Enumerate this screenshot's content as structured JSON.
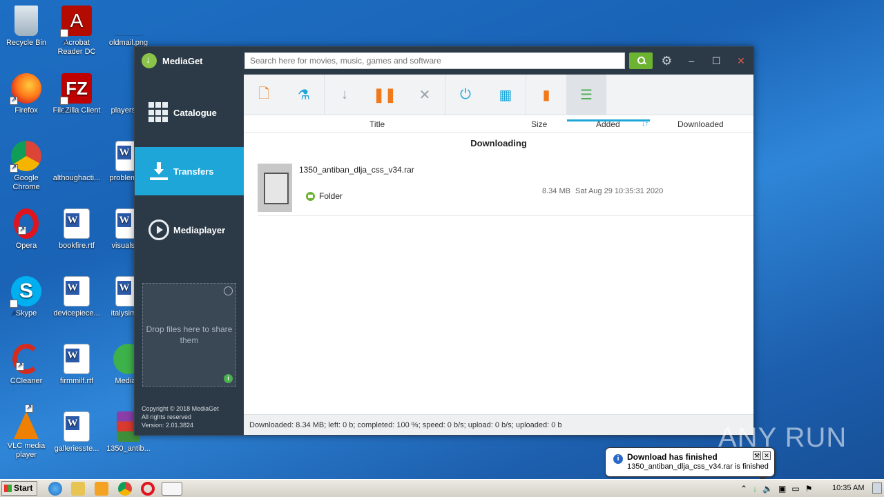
{
  "desktop": {
    "icons": [
      {
        "label": "Recycle Bin"
      },
      {
        "label": "Acrobat Reader DC"
      },
      {
        "label": "oldmail.png"
      },
      {
        "label": "Firefox"
      },
      {
        "label": "FileZilla Client"
      },
      {
        "label": "playersa..."
      },
      {
        "label": "Google Chrome"
      },
      {
        "label": "althoughacti..."
      },
      {
        "label": "problemp..."
      },
      {
        "label": "Opera"
      },
      {
        "label": "bookfire.rtf"
      },
      {
        "label": "visualstr..."
      },
      {
        "label": "Skype"
      },
      {
        "label": "devicepiece..."
      },
      {
        "label": "italysimil..."
      },
      {
        "label": "CCleaner"
      },
      {
        "label": "firmmilf.rtf"
      },
      {
        "label": "Media..."
      },
      {
        "label": "VLC media player"
      },
      {
        "label": "galleriesste..."
      },
      {
        "label": "1350_antib..."
      }
    ]
  },
  "app": {
    "title": "MediaGet",
    "search_placeholder": "Search here for movies, music, games and software",
    "nav": [
      {
        "label": "Catalogue"
      },
      {
        "label": "Transfers"
      },
      {
        "label": "Mediaplayer"
      }
    ],
    "dropzone_text": "Drop files here to share them",
    "copyright": [
      "Copyright © 2018 MediaGet",
      "All rights reserved",
      "Version: 2.01.3824"
    ],
    "columns": {
      "title": "Title",
      "size": "Size",
      "added": "Added",
      "sort_icon": "↓↑",
      "downloaded": "Downloaded"
    },
    "section_title": "Downloading",
    "transfer": {
      "name": "1350_antiban_dlja_css_v34.rar",
      "folder_label": "Folder",
      "size": "8.34 MB",
      "added": "Sat Aug 29 10:35:31 2020"
    },
    "status": "Downloaded: 8.34 MB; left: 0 b; completed: 100 %; speed: 0 b/s; upload: 0 b/s; uploaded: 0 b",
    "colors": {
      "accent": "#1ea6d9",
      "sidebar": "#2c3a47",
      "search_button": "#6bb330"
    }
  },
  "notification": {
    "title": "Download has finished",
    "text": "1350_antiban_dlja_css_v34.rar is finished"
  },
  "taskbar": {
    "start_label": "Start",
    "clock": "10:35 AM"
  },
  "watermark": "ANY RUN"
}
